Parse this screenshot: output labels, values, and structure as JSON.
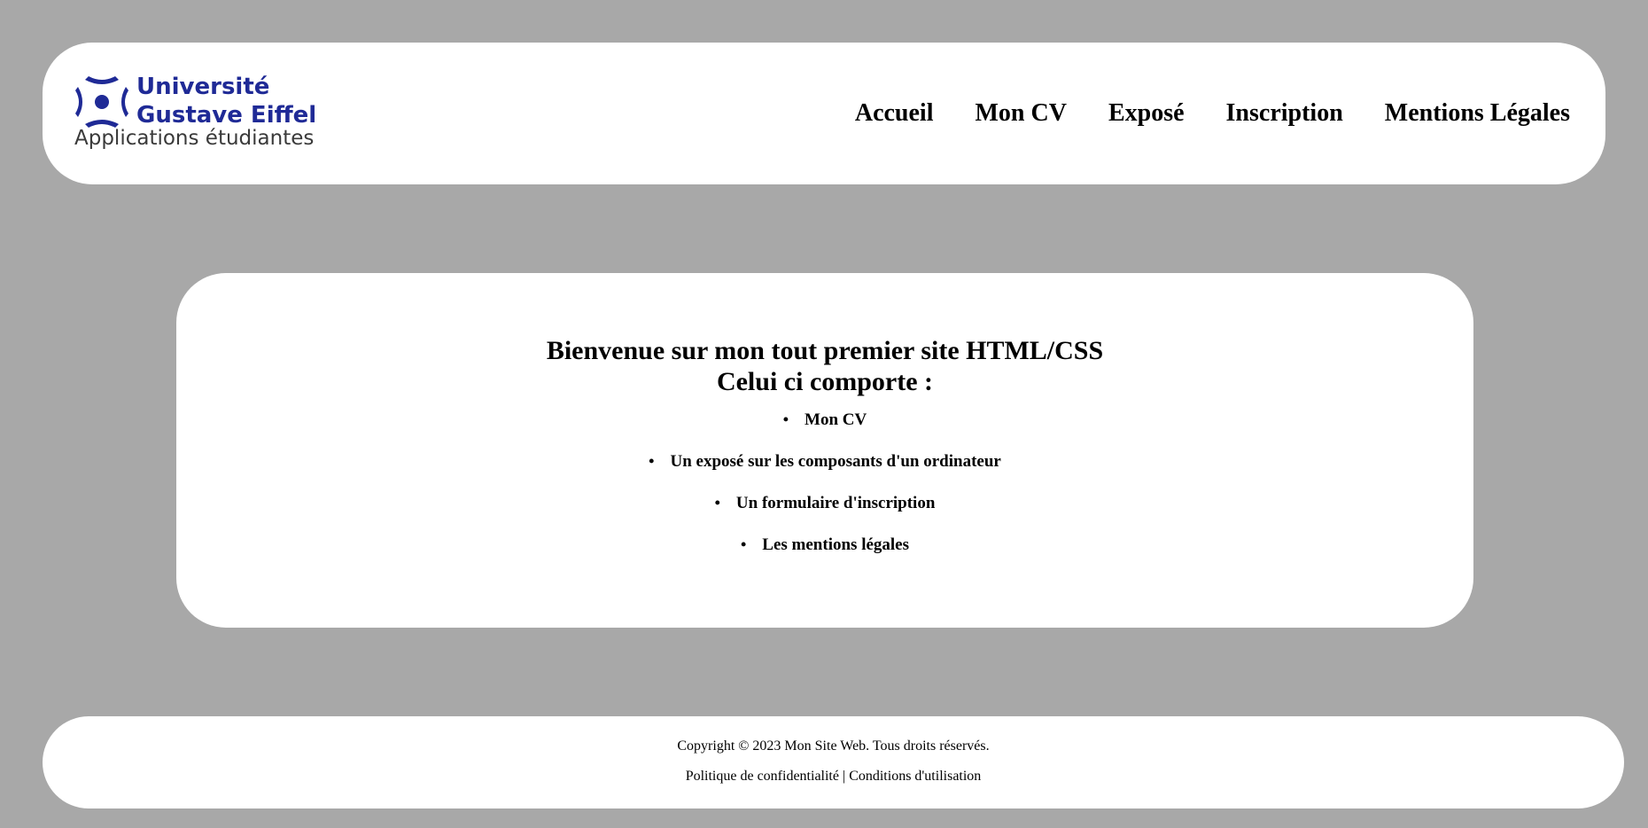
{
  "header": {
    "logo": {
      "line1": "Université",
      "line2": "Gustave Eiffel",
      "subtitle": "Applications étudiantes",
      "brand_color": "#1f2a96"
    },
    "nav": [
      {
        "label": "Accueil"
      },
      {
        "label": "Mon CV"
      },
      {
        "label": "Exposé"
      },
      {
        "label": "Inscription"
      },
      {
        "label": "Mentions Légales"
      }
    ]
  },
  "main": {
    "title_line1": "Bienvenue sur mon tout premier site HTML/CSS",
    "title_line2": "Celui ci comporte :",
    "items": [
      "Mon CV",
      "Un exposé sur les composants d'un ordinateur",
      "Un formulaire d'inscription",
      "Les mentions légales"
    ]
  },
  "footer": {
    "copyright": "Copyright © 2023 Mon Site Web. Tous droits réservés.",
    "privacy": "Politique de confidentialité",
    "separator": "|",
    "terms": "Conditions d'utilisation"
  },
  "colors": {
    "background": "#a8a8a8",
    "panel": "#ffffff"
  }
}
